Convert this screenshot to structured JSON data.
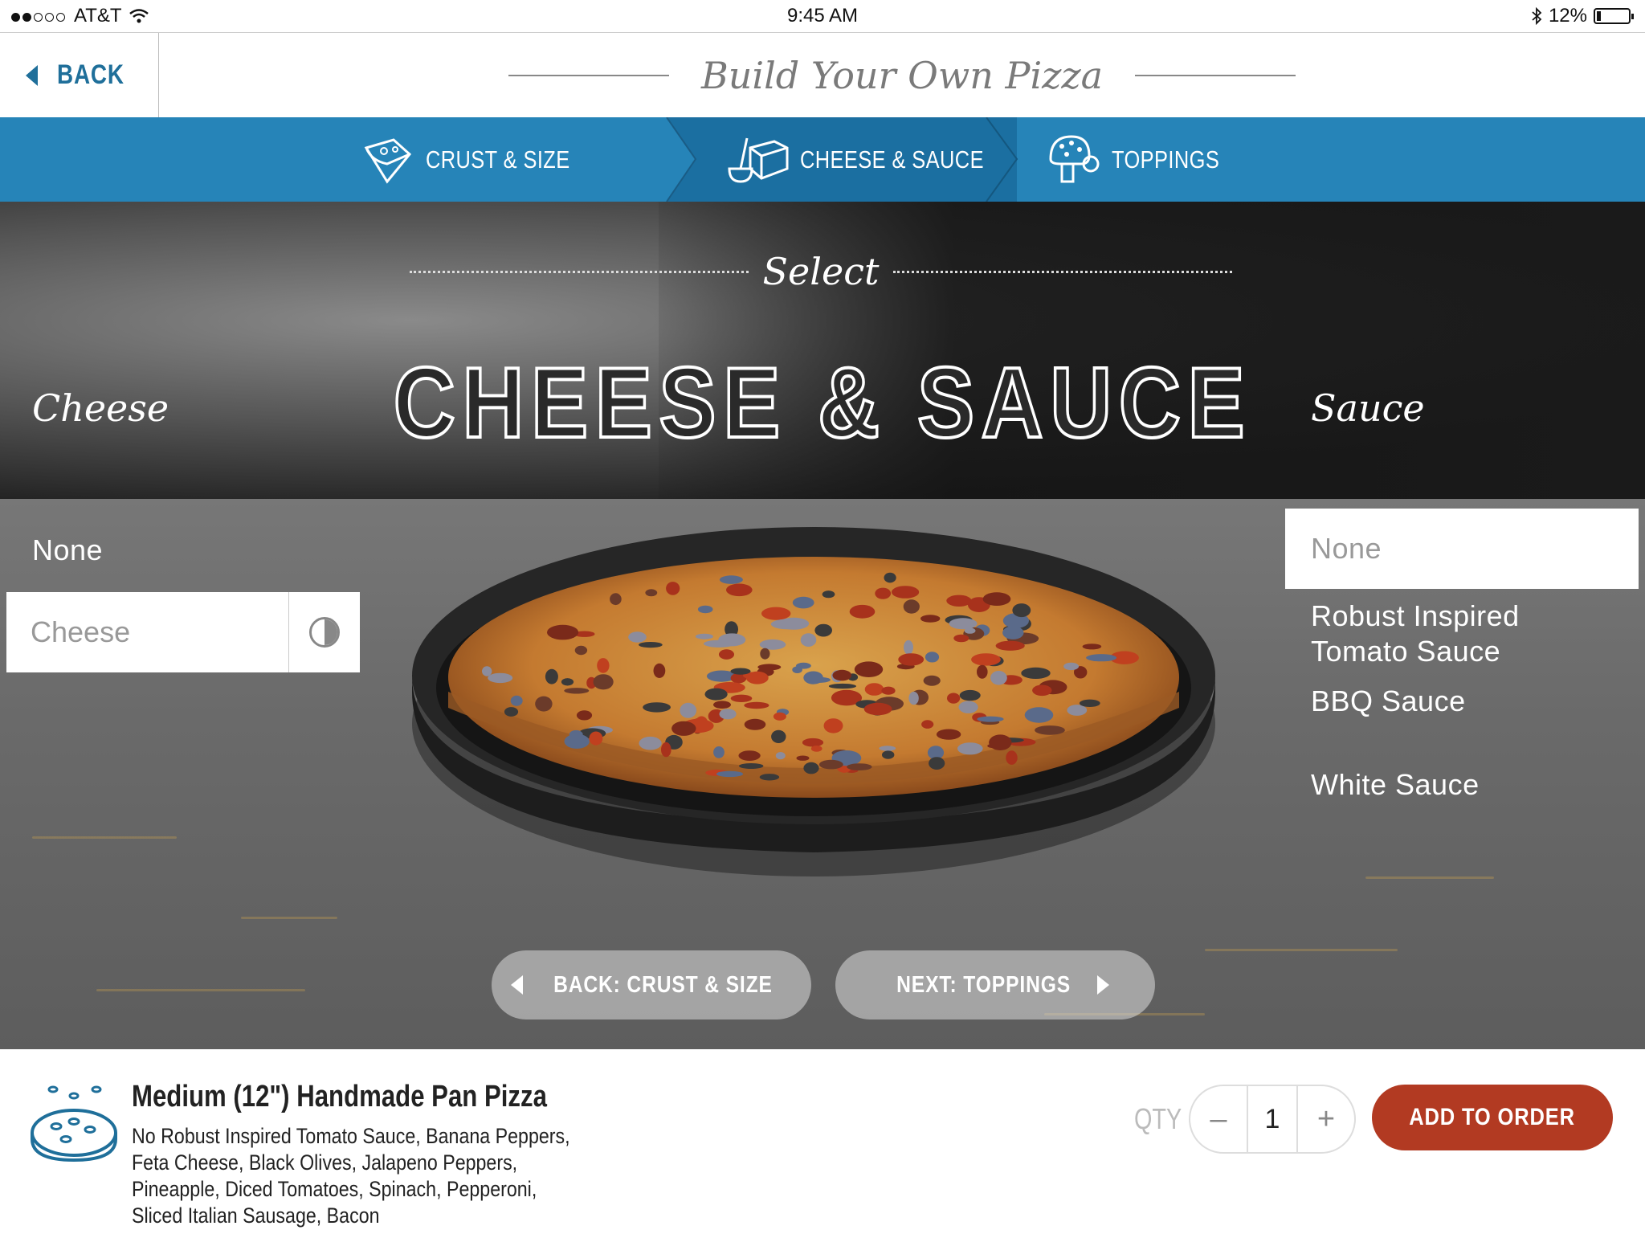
{
  "status_bar": {
    "carrier": "AT&T",
    "time": "9:45 AM",
    "battery": "12%",
    "battery_level": 0.12
  },
  "header": {
    "back_label": "BACK",
    "title": "Build Your Own Pizza"
  },
  "steps": [
    {
      "label": "CRUST & SIZE",
      "icon": "crust-size-icon"
    },
    {
      "label": "CHEESE & SAUCE",
      "icon": "cheese-sauce-icon",
      "active": true
    },
    {
      "label": "TOPPINGS",
      "icon": "toppings-icon"
    }
  ],
  "hero": {
    "select_word": "Select",
    "title": "CHEESE & SAUCE",
    "cheese_heading": "Cheese",
    "sauce_heading": "Sauce",
    "cheese_options": [
      "None",
      "Cheese"
    ],
    "sauce_options": [
      "None",
      "Robust Inspired\nTomato Sauce",
      "BBQ Sauce",
      "White Sauce"
    ],
    "back_button": "BACK: CRUST & SIZE",
    "next_button": "NEXT: TOPPINGS"
  },
  "footer": {
    "product_title": "Medium (12\") Handmade Pan Pizza",
    "product_desc": "No Robust Inspired Tomato Sauce, Banana Peppers, Feta Cheese, Black Olives, Jalapeno Peppers, Pineapple, Diced Tomatoes, Spinach, Pepperoni, Sliced Italian Sausage, Bacon",
    "qty_label": "QTY",
    "qty_minus": "–",
    "qty_value": "1",
    "qty_plus": "+",
    "add_button": "ADD TO ORDER"
  },
  "colors": {
    "nav_blue": "#2684b8",
    "nav_active": "#1b6fa1",
    "accent_red": "#b23a22",
    "back_blue": "#1f6f9a"
  }
}
